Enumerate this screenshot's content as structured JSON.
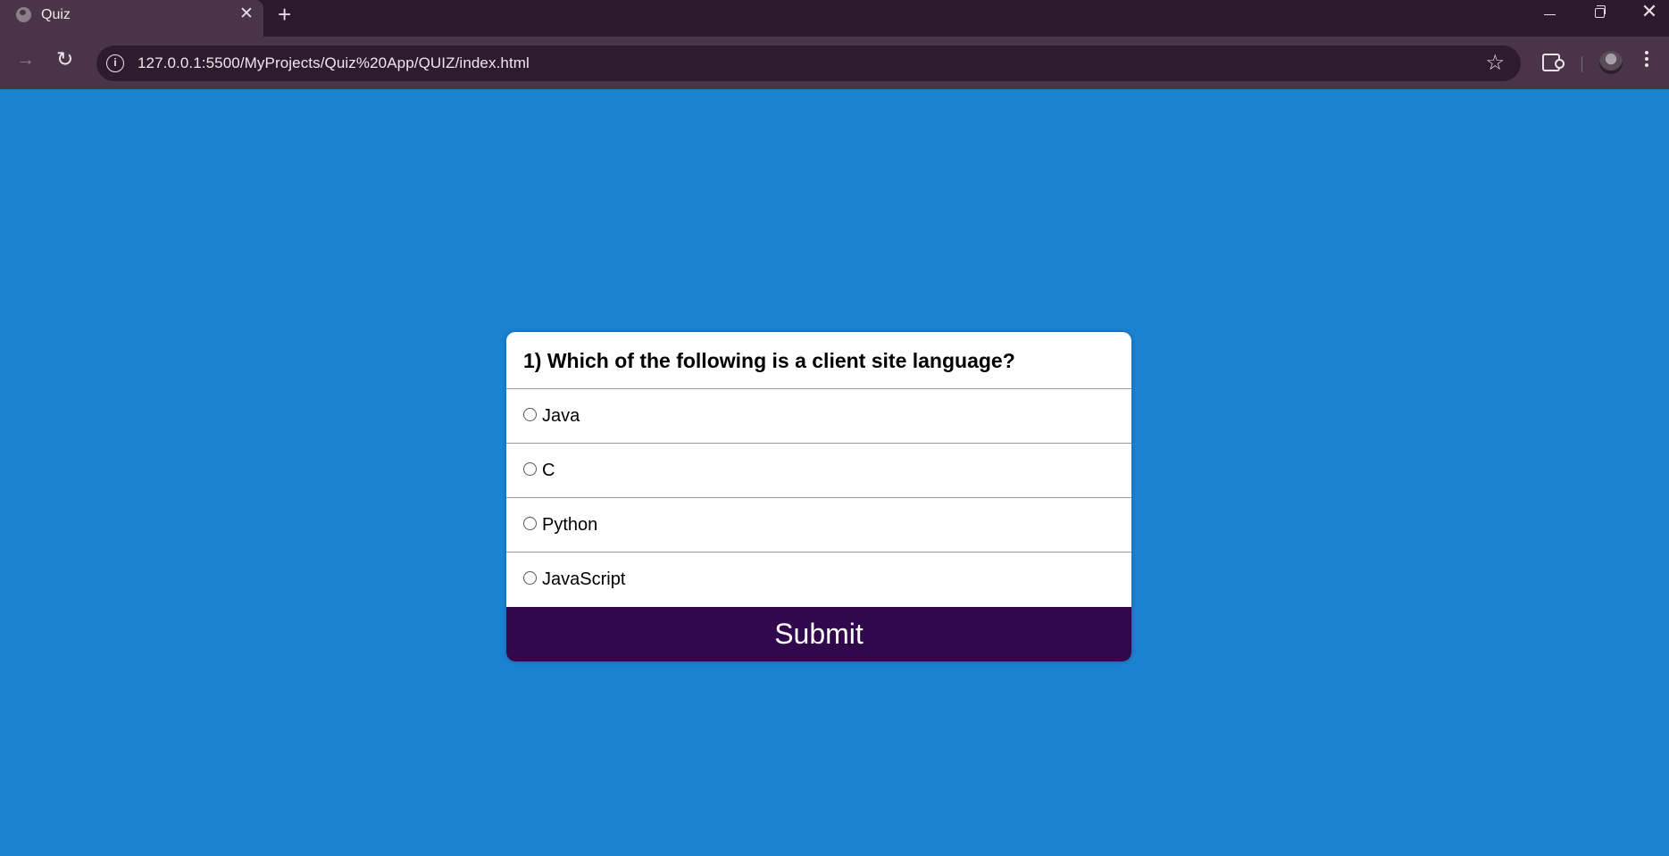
{
  "browser": {
    "tab_title": "Quiz",
    "tab_close": "✕",
    "new_tab": "+",
    "url": "127.0.0.1:5500/MyProjects/Quiz%20App/QUIZ/index.html",
    "info_glyph": "i",
    "star_glyph": "☆",
    "forward_glyph": "→",
    "reload_glyph": "↻",
    "close_glyph": "✕"
  },
  "quiz": {
    "question": "1) Which of the following is a client site language?",
    "options": [
      {
        "label": "Java"
      },
      {
        "label": "C"
      },
      {
        "label": "Python"
      },
      {
        "label": "JavaScript"
      }
    ],
    "submit_label": "Submit"
  },
  "colors": {
    "page_background": "#1b81d1",
    "submit_background": "#31084b",
    "browser_frame": "#2c1a2c",
    "browser_toolbar": "#4a3448"
  },
  "icons": [
    "globe-icon",
    "close-icon",
    "plus-icon",
    "minimize-icon",
    "restore-icon",
    "forward-arrow-icon",
    "reload-icon",
    "info-icon",
    "star-icon",
    "extensions-icon",
    "avatar",
    "kebab-menu-icon"
  ]
}
